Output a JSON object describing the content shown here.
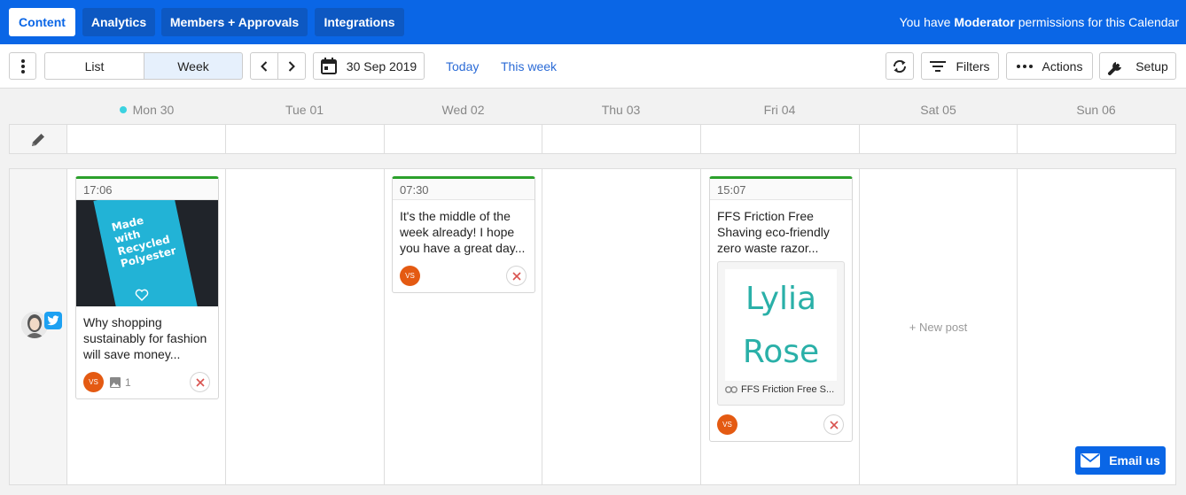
{
  "topbar": {
    "tabs": [
      {
        "label": "Content",
        "active": true
      },
      {
        "label": "Analytics"
      },
      {
        "label": "Members + Approvals"
      },
      {
        "label": "Integrations"
      }
    ],
    "permission_prefix": "You have ",
    "permission_role": "Moderator",
    "permission_suffix": " permissions for this Calendar"
  },
  "toolbar": {
    "view_list": "List",
    "view_week": "Week",
    "date": "30 Sep 2019",
    "today": "Today",
    "this_week": "This week",
    "filters": "Filters",
    "actions": "Actions",
    "setup": "Setup"
  },
  "days": [
    "Mon 30",
    "Tue 01",
    "Wed 02",
    "Thu 03",
    "Fri 04",
    "Sat 05",
    "Sun 06"
  ],
  "posts": {
    "mon": {
      "time": "17:06",
      "image_text": [
        "Made",
        "with",
        "Recycled",
        "Polyester"
      ],
      "text": "Why shopping sustainably for fashion will save money...",
      "avatar": "VS",
      "image_count": "1"
    },
    "wed": {
      "time": "07:30",
      "text": "It's the middle of the week already! I hope you have a great day...",
      "avatar": "VS"
    },
    "fri": {
      "time": "15:07",
      "text": "FFS Friction Free Shaving eco-friendly zero waste razor...",
      "preview_line1": "Lylia",
      "preview_line2": "Rose",
      "link_label": "FFS Friction Free S...",
      "avatar": "VS"
    }
  },
  "new_post": "+ New post",
  "email_us": "Email us",
  "colors": {
    "brand": "#0a66e6",
    "approved": "#2ca02c",
    "avatar": "#e45a12",
    "today_dot": "#3bd2e0",
    "twitter": "#1da1f2"
  }
}
